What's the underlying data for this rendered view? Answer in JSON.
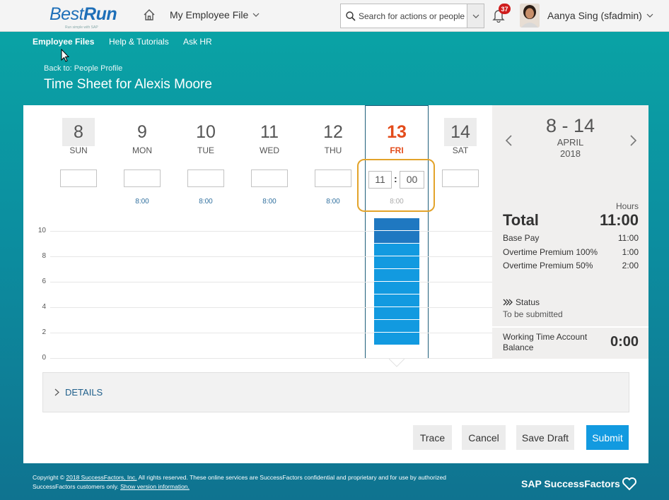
{
  "header": {
    "logo_main": "Best",
    "logo_bold": "Run",
    "logo_tagline": "Run simple with SAP",
    "module": "My Employee File",
    "search_placeholder": "Search for actions or people",
    "notifications": "37",
    "user": "Aanya Sing (sfadmin)"
  },
  "nav": {
    "items": [
      "Employee Files",
      "Help & Tutorials",
      "Ask HR"
    ]
  },
  "page": {
    "back_link": "Back to: People Profile",
    "title": "Time Sheet for Alexis Moore"
  },
  "week": {
    "days": [
      {
        "num": "8",
        "name": "SUN",
        "planned": ""
      },
      {
        "num": "9",
        "name": "MON",
        "planned": "8:00"
      },
      {
        "num": "10",
        "name": "TUE",
        "planned": "8:00"
      },
      {
        "num": "11",
        "name": "WED",
        "planned": "8:00"
      },
      {
        "num": "12",
        "name": "THU",
        "planned": "8:00"
      },
      {
        "num": "13",
        "name": "FRI",
        "planned": "8:00"
      },
      {
        "num": "14",
        "name": "SAT",
        "planned": ""
      }
    ],
    "fri_hours": "11",
    "fri_minutes": "00",
    "y_axis": [
      "10",
      "8",
      "6",
      "4",
      "2",
      "0"
    ]
  },
  "bar": {
    "total_hours": 11,
    "segments": [
      {
        "hours": 1,
        "color": "#1f78c1"
      },
      {
        "hours": 1,
        "color": "#1f78c1"
      },
      {
        "hours": 8,
        "color": "#129ae0"
      }
    ]
  },
  "summary": {
    "range": "8 - 14",
    "month": "APRIL",
    "year": "2018",
    "hours_header": "Hours",
    "total_label": "Total",
    "total_value": "11:00",
    "rows": [
      {
        "label": "Base Pay",
        "value": "11:00"
      },
      {
        "label": "Overtime Premium 100%",
        "value": "1:00"
      },
      {
        "label": "Overtime Premium 50%",
        "value": "2:00"
      }
    ],
    "status_label": "Status",
    "status_value": "To be submitted",
    "wta_label": "Working Time Account Balance",
    "wta_value": "0:00"
  },
  "details": {
    "label": "DETAILS"
  },
  "buttons": {
    "trace": "Trace",
    "cancel": "Cancel",
    "save_draft": "Save Draft",
    "submit": "Submit"
  },
  "footer": {
    "copyright_prefix": "Copyright ©",
    "copyright_link": "2018 SuccessFactors, Inc.",
    "copyright_rest": "All rights reserved. These online services are SuccessFactors confidential and proprietary and for use by authorized SuccessFactors customers only.",
    "version_link": "Show version information.",
    "brand": "SAP SuccessFactors"
  },
  "colors": {
    "accent": "#129ae0",
    "today": "#e34c1b",
    "highlight": "#e3a32a",
    "header_teal": "#0aa6a6"
  }
}
